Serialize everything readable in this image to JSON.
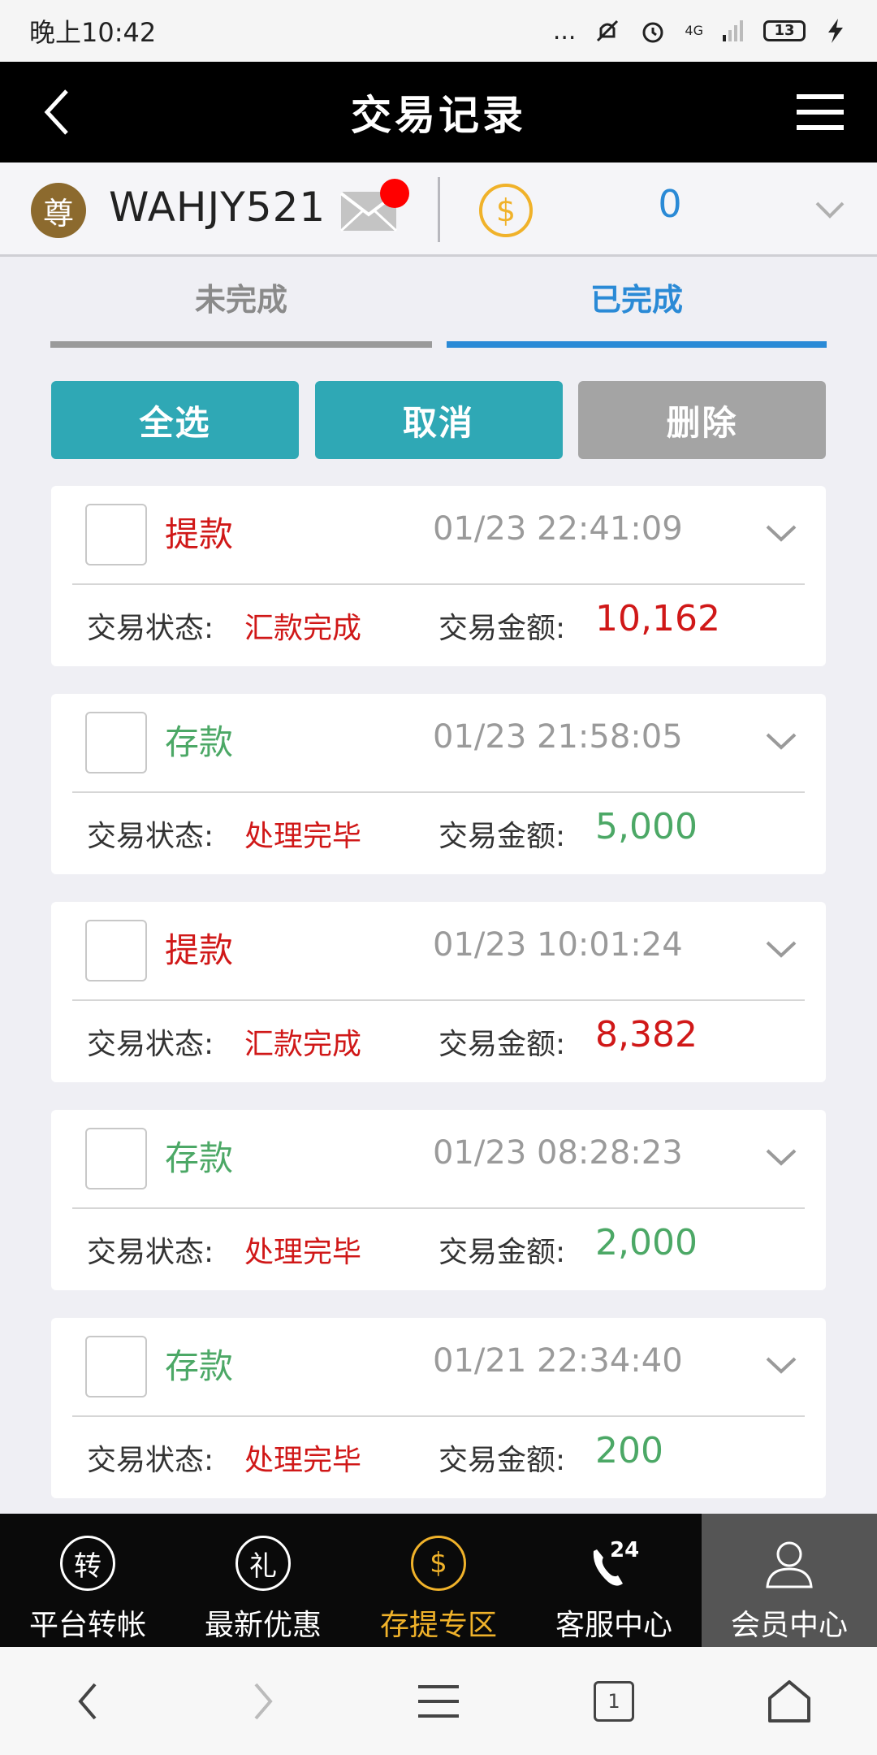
{
  "status_bar": {
    "time": "晚上10:42",
    "dots": "...",
    "network": "4G",
    "battery": "13"
  },
  "header": {
    "title": "交易记录"
  },
  "user": {
    "avatar_text": "尊",
    "username": "WAHJY521",
    "balance": "0"
  },
  "tabs": [
    {
      "label": "未完成"
    },
    {
      "label": "已完成"
    }
  ],
  "actions": {
    "select_all": "全选",
    "cancel": "取消",
    "delete": "删除"
  },
  "records": [
    {
      "type": "提款",
      "kind": "withdraw",
      "time": "01/23 22:41:09",
      "status_label": "交易状态:",
      "status": "汇款完成",
      "amount_label": "交易金额:",
      "amount": "10,162"
    },
    {
      "type": "存款",
      "kind": "deposit",
      "time": "01/23 21:58:05",
      "status_label": "交易状态:",
      "status": "处理完毕",
      "amount_label": "交易金额:",
      "amount": "5,000"
    },
    {
      "type": "提款",
      "kind": "withdraw",
      "time": "01/23 10:01:24",
      "status_label": "交易状态:",
      "status": "汇款完成",
      "amount_label": "交易金额:",
      "amount": "8,382"
    },
    {
      "type": "存款",
      "kind": "deposit",
      "time": "01/23 08:28:23",
      "status_label": "交易状态:",
      "status": "处理完毕",
      "amount_label": "交易金额:",
      "amount": "2,000"
    },
    {
      "type": "存款",
      "kind": "deposit",
      "time": "01/21 22:34:40",
      "status_label": "交易状态:",
      "status": "处理完毕",
      "amount_label": "交易金额:",
      "amount": "200"
    }
  ],
  "bottom_nav": [
    {
      "label": "平台转帐",
      "icon_text": "转"
    },
    {
      "label": "最新优惠",
      "icon_text": "礼"
    },
    {
      "label": "存提专区",
      "icon_text": "$"
    },
    {
      "label": "客服中心",
      "icon_text": "24"
    },
    {
      "label": "会员中心"
    }
  ],
  "system_nav": {
    "tab_count": "1"
  },
  "colors": {
    "header_bg": "#000000",
    "accent_blue": "#2a8ad6",
    "teal_button": "#2fa8b5",
    "withdraw_red": "#d01818",
    "deposit_green": "#4ca866",
    "nav_highlight": "#f0b22a"
  }
}
